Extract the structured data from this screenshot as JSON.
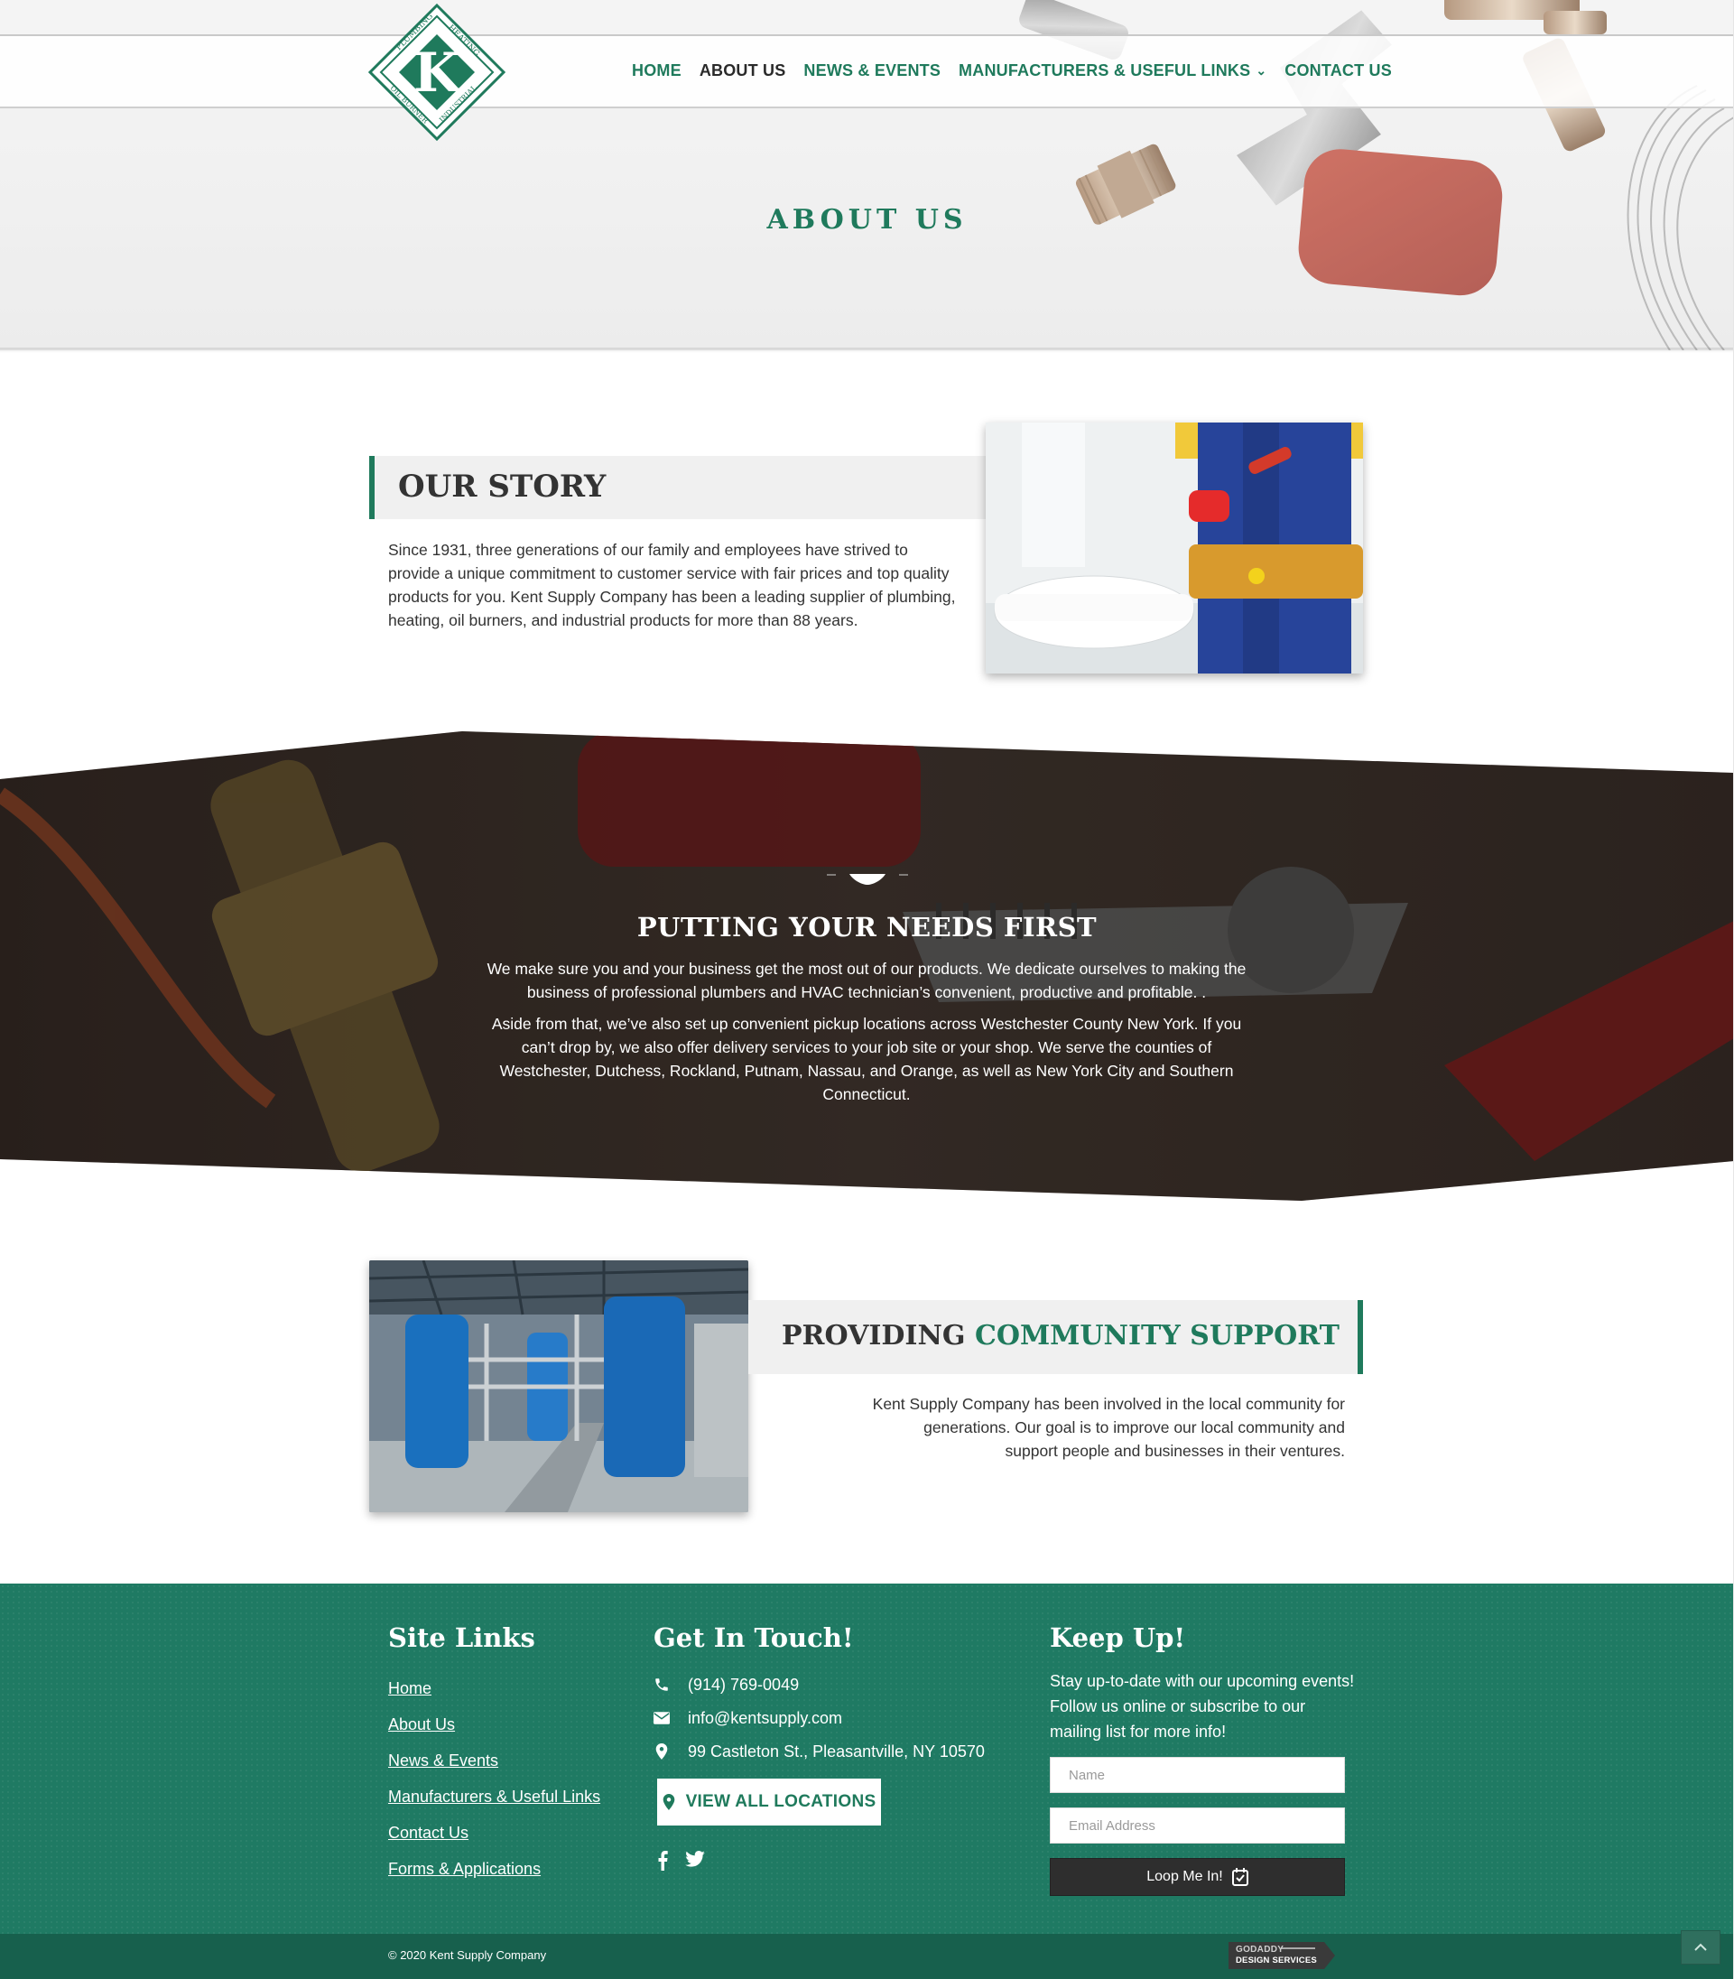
{
  "brand": {
    "accent": "#1f7a5c",
    "footer_bg": "#1f7a63",
    "subfooter_bg": "#17604d",
    "logo": {
      "letter": "K",
      "words": [
        "PLUMBING",
        "HEATING",
        "OIL BURNER",
        "INDUSTRIAL"
      ]
    }
  },
  "nav": {
    "items": [
      {
        "label": "HOME",
        "active": false
      },
      {
        "label": "ABOUT US",
        "active": true
      },
      {
        "label": "NEWS & EVENTS",
        "active": false
      },
      {
        "label": "MANUFACTURERS & USEFUL LINKS",
        "active": false,
        "has_dropdown": true
      },
      {
        "label": "CONTACT US",
        "active": false
      }
    ],
    "dropdown_icon": "chevron-down-icon"
  },
  "hero": {
    "title": "ABOUT US"
  },
  "story": {
    "heading": "OUR STORY",
    "text": "Since 1931, three generations of our family and employees have strived to provide a unique commitment to customer service with fair prices and top quality products for you. Kent Supply Company has been a leading supplier of plumbing, heating, oil burners, and industrial products for more than 88 years."
  },
  "needs": {
    "heading": "PUTTING YOUR NEEDS FIRST",
    "paragraph1": "We make sure you and your business get the most out of our products. We dedicate ourselves to making the business of professional plumbers and HVAC technician’s convenient, productive and profitable. .",
    "paragraph2": "Aside from that, we’ve also set up convenient pickup locations across Westchester County New York. If you can’t drop by, we also offer delivery services to your job site or your shop. We serve the counties of Westchester, Dutchess, Rockland, Putnam, Nassau, and Orange, as well as New York City and Southern Connecticut."
  },
  "community": {
    "heading_plain": "PROVIDING",
    "heading_accent": "COMMUNITY SUPPORT",
    "text": "Kent Supply Company has been involved in the local community for generations. Our goal is to improve our local community and support people and businesses in their ventures."
  },
  "footer": {
    "site_links": {
      "title": "Site Links",
      "links": [
        "Home",
        "About Us",
        "News & Events",
        "Manufacturers & Useful Links",
        "Contact Us",
        "Forms & Applications"
      ]
    },
    "contact": {
      "title": "Get In Touch!",
      "phone": "(914) 769-0049",
      "email": "info@kentsupply.com",
      "address": "99 Castleton St., Pleasantville, NY 10570",
      "locations_button": "VIEW ALL LOCATIONS",
      "icons": [
        "phone-icon",
        "envelope-icon",
        "map-pin-icon"
      ],
      "social": [
        "facebook-icon",
        "twitter-icon"
      ]
    },
    "keep_up": {
      "title": "Keep Up!",
      "text": "Stay up-to-date with our upcoming events! Follow us online or subscribe to our mailing list for more info!",
      "name_placeholder": "Name",
      "email_placeholder": "Email Address",
      "submit_label": "Loop Me In!",
      "submit_icon": "calendar-check-icon"
    },
    "copyright": "© 2020 Kent Supply Company",
    "badge_line1": "GODADDY",
    "badge_line2": "DESIGN SERVICES",
    "scroll_top_icon": "chevron-up-icon"
  }
}
